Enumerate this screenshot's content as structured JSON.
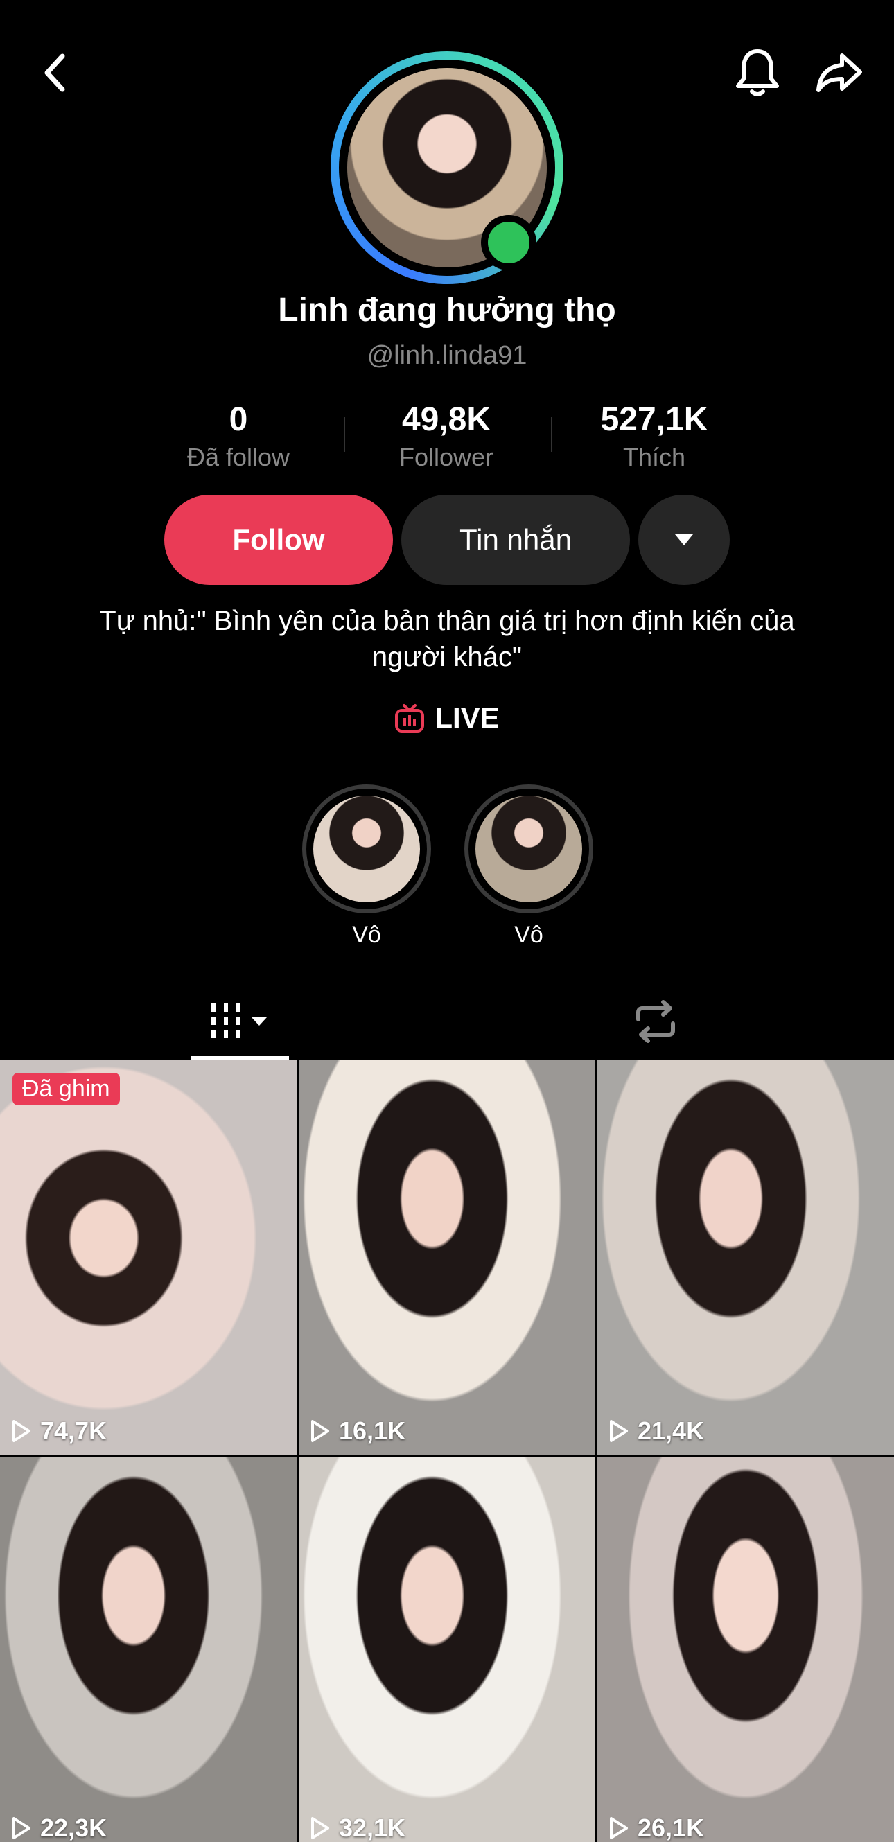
{
  "profile": {
    "display_name": "Linh đang hưởng thọ",
    "handle": "@linh.linda91",
    "bio": "Tự nhủ:\" Bình yên của bản thân giá trị hơn định kiến của người khác\"",
    "live_label": "LIVE"
  },
  "stats": [
    {
      "value": "0",
      "label": "Đã follow"
    },
    {
      "value": "49,8K",
      "label": "Follower"
    },
    {
      "value": "527,1K",
      "label": "Thích"
    }
  ],
  "actions": {
    "follow_label": "Follow",
    "message_label": "Tin nhắn"
  },
  "highlights": [
    {
      "label": "Vô"
    },
    {
      "label": "Vô"
    }
  ],
  "videos": [
    {
      "views": "74,7K",
      "pinned_label": "Đã ghim"
    },
    {
      "views": "16,1K"
    },
    {
      "views": "21,4K"
    },
    {
      "views": "22,3K"
    },
    {
      "views": "32,1K"
    },
    {
      "views": "26,1K"
    }
  ],
  "colors": {
    "accent": "#ea3b56",
    "online": "#2ec25a",
    "secondary_button": "#262626",
    "muted_text": "#8a8a8a"
  },
  "icons": [
    "back-icon",
    "bell-icon",
    "share-icon",
    "chevron-down-icon",
    "live-tv-icon",
    "grid-icon",
    "repost-icon",
    "play-icon"
  ]
}
